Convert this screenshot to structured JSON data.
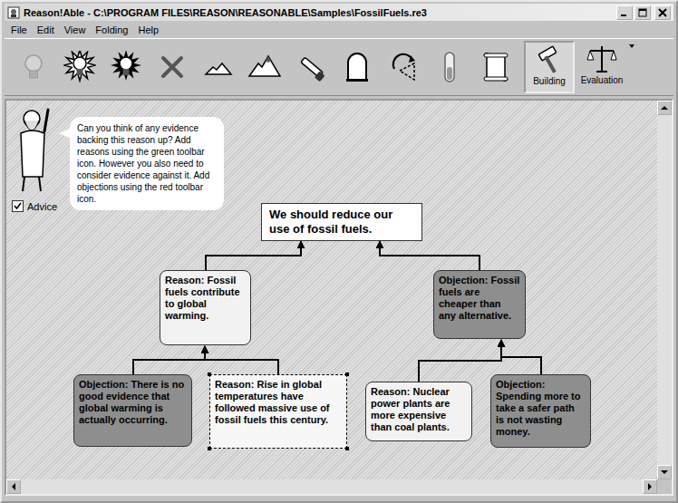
{
  "window": {
    "title": "Reason!Able - C:\\PROGRAM FILES\\REASON\\REASONABLE\\Samples\\FossilFuels.re3"
  },
  "menu": [
    "File",
    "Edit",
    "View",
    "Folding",
    "Help"
  ],
  "toolbar": {
    "tools": [
      {
        "disabled": true
      },
      {
        "disabled": false
      },
      {
        "disabled": false
      },
      {
        "disabled": false
      },
      {
        "disabled": false
      },
      {
        "disabled": false
      },
      {
        "disabled": false
      },
      {
        "disabled": false
      },
      {
        "disabled": false
      },
      {
        "disabled": false
      },
      {
        "disabled": false
      }
    ],
    "modes": [
      {
        "label": "Building",
        "selected": true
      },
      {
        "label": "Evaluation",
        "selected": false
      }
    ]
  },
  "advice": {
    "text": "Can you think of any evidence backing this reason up? Add reasons using the green toolbar icon. However you also need to consider evidence against it. Add objections using the red toolbar icon.",
    "checkbox": {
      "label": "Advice",
      "checked": true
    }
  },
  "argument": {
    "claim": "We should reduce our use of fossil fuels.",
    "premises": [
      {
        "kind": "reason",
        "label": "Reason:",
        "text": "Fossil fuels contribute to global warming.",
        "selected": false,
        "premises": [
          {
            "kind": "objection",
            "label": "Objection:",
            "text": "There is no good evidence that global warming is actually occurring.",
            "selected": false
          },
          {
            "kind": "reason",
            "label": "Reason:",
            "text": "Rise in global temperatures have followed massive use of fossil fuels this century.",
            "selected": true
          }
        ]
      },
      {
        "kind": "objection",
        "label": "Objection:",
        "text": "Fossil fuels are cheaper than any alternative.",
        "selected": false,
        "premises": [
          {
            "kind": "reason",
            "label": "Reason:",
            "text": "Nuclear power plants are more expensive than coal plants.",
            "selected": false
          },
          {
            "kind": "objection",
            "label": "Objection:",
            "text": "Spending more to take a safer path is not wasting money.",
            "selected": false
          }
        ]
      }
    ]
  }
}
